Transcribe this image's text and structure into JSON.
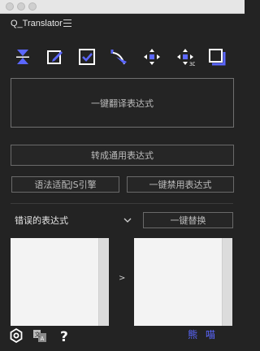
{
  "window": {
    "title": "Q_Translator"
  },
  "toolbar": {
    "icons": [
      "cursor-split-icon",
      "edit-icon",
      "checkbox-icon",
      "pen-corner-icon",
      "move-arrows-icon",
      "move-arrows-3d-icon",
      "layer-square-icon"
    ]
  },
  "buttons": {
    "translate_all": "一键翻译表达式",
    "convert_universal": "转成通用表达式",
    "adapt_js_engine": "语法适配JS引擎",
    "disable_all": "一键禁用表达式",
    "replace_all": "一键替换"
  },
  "dropdown": {
    "selected": "错误的表达式"
  },
  "arrow": ">",
  "footer": {
    "brand": "熊 喵"
  },
  "colors": {
    "accent": "#5b67ff",
    "background": "#232323"
  }
}
